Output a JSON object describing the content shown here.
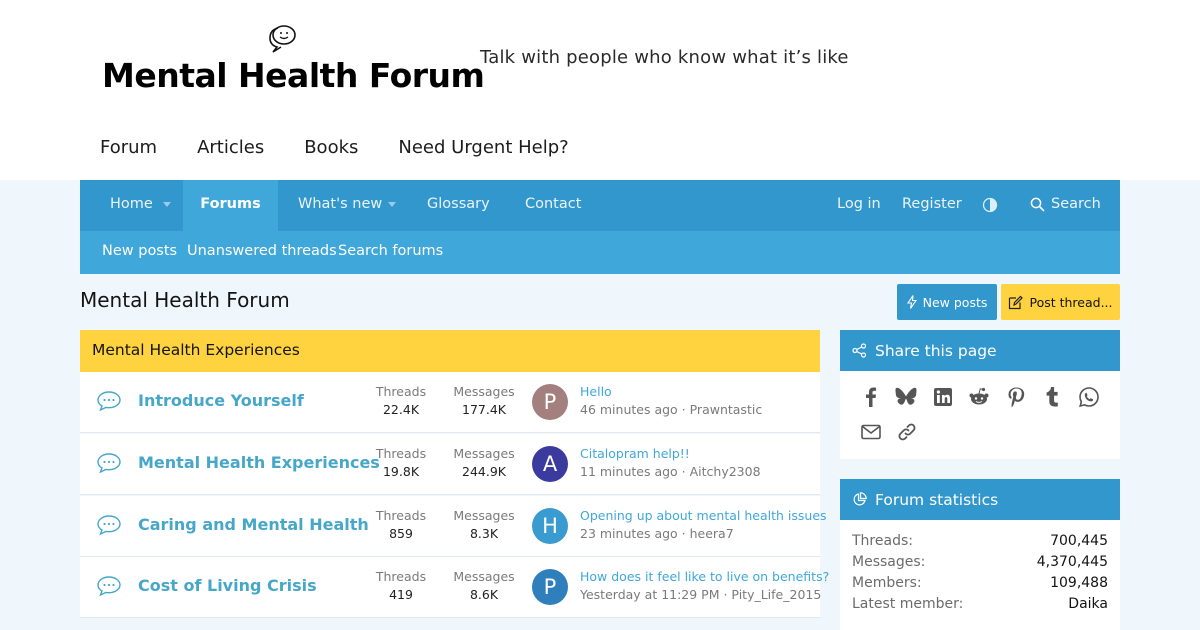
{
  "header": {
    "logo_text": "Mental Health Forum",
    "tagline": "Talk with people who know what it’s like",
    "site_links": [
      "Forum",
      "Articles",
      "Books",
      "Need Urgent Help?"
    ]
  },
  "main_nav": {
    "home": "Home",
    "forums": "Forums",
    "whats_new": "What's new",
    "glossary": "Glossary",
    "contact": "Contact",
    "log_in": "Log in",
    "register": "Register",
    "search": "Search"
  },
  "sub_nav": {
    "new_posts": "New posts",
    "unanswered": "Unanswered threads",
    "search_forums": "Search forums"
  },
  "page": {
    "title": "Mental Health Forum",
    "new_posts_button": "New posts",
    "post_thread_button": "Post thread..."
  },
  "category": {
    "title": "Mental Health Experiences"
  },
  "stat_labels": {
    "threads": "Threads",
    "messages": "Messages"
  },
  "nodes": [
    {
      "title": "Introduce Yourself",
      "threads": "22.4K",
      "messages": "177.4K",
      "avatar_letter": "P",
      "avatar_color": "#a3807d",
      "latest_title": "Hello",
      "latest_meta": "46 minutes ago · Prawntastic"
    },
    {
      "title": "Mental Health Experiences",
      "threads": "19.8K",
      "messages": "244.9K",
      "avatar_letter": "A",
      "avatar_color": "#3b3a9e",
      "latest_title": "Citalopram help!!",
      "latest_meta": "11 minutes ago · Aitchy2308"
    },
    {
      "title": "Caring and Mental Health",
      "threads": "859",
      "messages": "8.3K",
      "avatar_letter": "H",
      "avatar_color": "#3a9bd1",
      "latest_title": "Opening up about mental health issues",
      "latest_meta": "23 minutes ago · heera7"
    },
    {
      "title": "Cost of Living Crisis",
      "threads": "419",
      "messages": "8.6K",
      "avatar_letter": "P",
      "avatar_color": "#2f7fbd",
      "latest_title": "How does it feel like to live on benefits?",
      "latest_meta": "Yesterday at 11:29 PM · Pity_Life_2015"
    }
  ],
  "share": {
    "title": "Share this page",
    "icons": [
      "facebook-icon",
      "bluesky-icon",
      "linkedin-icon",
      "reddit-icon",
      "pinterest-icon",
      "tumblr-icon",
      "whatsapp-icon",
      "email-icon",
      "link-icon"
    ]
  },
  "forum_stats": {
    "title": "Forum statistics",
    "rows": [
      {
        "label": "Threads:",
        "value": "700,445"
      },
      {
        "label": "Messages:",
        "value": "4,370,445"
      },
      {
        "label": "Members:",
        "value": "109,488"
      },
      {
        "label": "Latest member:",
        "value": "Daika"
      }
    ]
  },
  "colors": {
    "nav": "#3297cd",
    "subnav": "#3fa7d9",
    "accent_yellow": "#ffd23f",
    "link": "#47a7c9"
  }
}
